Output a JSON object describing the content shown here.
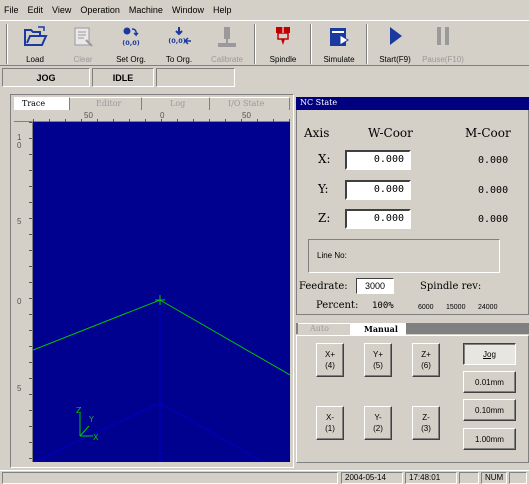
{
  "menu": [
    "File",
    "Edit",
    "View",
    "Operation",
    "Machine",
    "Window",
    "Help"
  ],
  "toolbar": {
    "load": "Load",
    "clear": "Clear",
    "set_org": "Set Org.",
    "to_org": "To Org.",
    "calibrate": "Calibrate",
    "spindle": "Spindle",
    "simulate": "Simulate",
    "start": "Start(F9)",
    "pause": "Pause(F10)",
    "org_caption": "(0,0)"
  },
  "status": {
    "mode": "JOG",
    "state": "IDLE"
  },
  "tabs": {
    "trace": "Trace",
    "editor": "Editor",
    "log": "Log",
    "io": "I/O State"
  },
  "ruler": {
    "left": "50",
    "mid": "0",
    "right": "50",
    "v_top": "10",
    "v_mid": "5",
    "v_zero": "0",
    "v_bot": "5"
  },
  "axis_labels": {
    "z": "Z",
    "y": "Y",
    "x": "X"
  },
  "nc": {
    "title": "NC State",
    "axis_header": "Axis",
    "w_header": "W-Coor",
    "m_header": "M-Coor",
    "rows": [
      {
        "axis": "X:",
        "w": "0.000",
        "m": "0.000"
      },
      {
        "axis": "Y:",
        "w": "0.000",
        "m": "0.000"
      },
      {
        "axis": "Z:",
        "w": "0.000",
        "m": "0.000"
      }
    ],
    "line_no": "Line No:",
    "feedrate_label": "Feedrate:",
    "feedrate": "3000",
    "spindle_label": "Spindle rev:",
    "percent_label": "Percent:",
    "percent": "100%",
    "spindle_scale": [
      "6000",
      "15000",
      "24000"
    ]
  },
  "manual": {
    "tab_auto": "Auto",
    "tab_manual": "Manual",
    "xplus": "X+",
    "xplus_k": "(4)",
    "yplus": "Y+",
    "yplus_k": "(5)",
    "zplus": "Z+",
    "zplus_k": "(6)",
    "xminus": "X-",
    "xminus_k": "(1)",
    "yminus": "Y-",
    "yminus_k": "(2)",
    "zminus": "Z-",
    "zminus_k": "(3)",
    "jog": "Jog",
    "step1": "0.01mm",
    "step2": "0.10mm",
    "step3": "1.00mm"
  },
  "statusbar": {
    "date": "2004-05-14",
    "time": "17:48:01",
    "num": "NUM"
  }
}
